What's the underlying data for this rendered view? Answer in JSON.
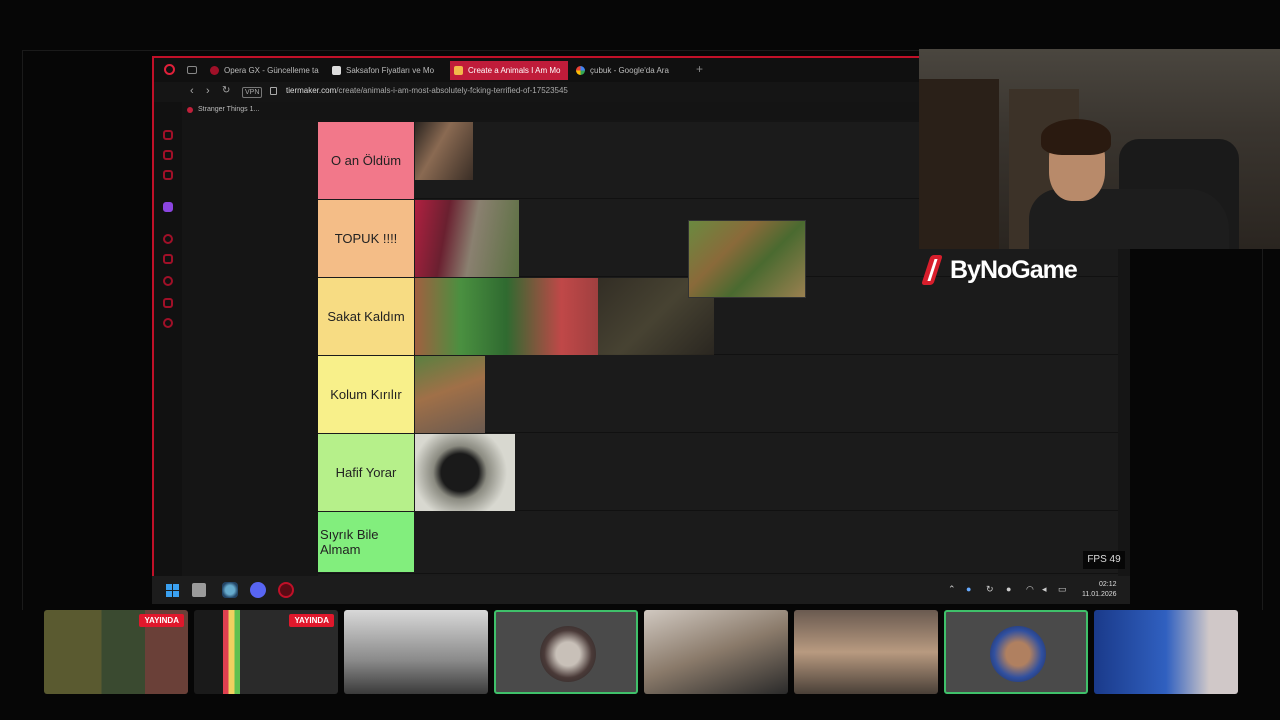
{
  "browser": {
    "tabs": [
      {
        "label": "Opera GX - Güncelleme ta",
        "active": false
      },
      {
        "label": "Saksafon Fiyatları ve Mo",
        "active": false
      },
      {
        "label": "Create a Animals I Am Mo",
        "active": true
      },
      {
        "label": "çubuk - Google'da Ara",
        "active": false
      }
    ],
    "new_tab": "+",
    "vpn": "VPN",
    "url_host": "tiermaker.com",
    "url_path": "/create/animals-i-am-most-absolutely-fcking-terrified-of-17523545",
    "bookmark": "Stranger Things 1..."
  },
  "tiers": [
    {
      "label": "O an Öldüm",
      "color": "#f2788a"
    },
    {
      "label": "TOPUK !!!!",
      "color": "#f4bd87"
    },
    {
      "label": "Sakat Kaldım",
      "color": "#f7dc83"
    },
    {
      "label": "Kolum Kırılır",
      "color": "#f8f08a"
    },
    {
      "label": "Hafif Yorar",
      "color": "#b6f08a"
    },
    {
      "label": "Sıyrık Bile Almam",
      "color": "#82ee7d"
    }
  ],
  "overlay": {
    "brand": "ByNoGame",
    "fps": "FPS 49"
  },
  "taskbar": {
    "time": "02:12",
    "date": "11.01.2026"
  },
  "participants": {
    "live_label": "YAYINDA"
  },
  "colors": {
    "opera_accent": "#c01028",
    "live_badge": "#e0182c",
    "highlight_border": "#3fc06a"
  }
}
